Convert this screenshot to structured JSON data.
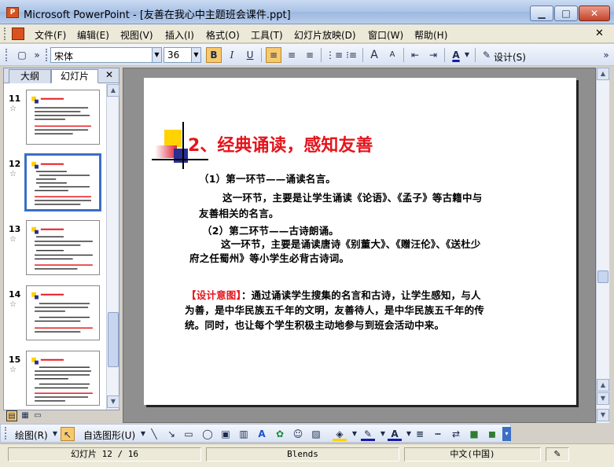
{
  "window": {
    "app_icon": "powerpoint-icon",
    "title": "Microsoft PowerPoint - [友善在我心中主题班会课件.ppt]",
    "min_glyph": "▁",
    "max_glyph": "□",
    "close_glyph": "✕"
  },
  "menu": {
    "items": [
      "文件(F)",
      "编辑(E)",
      "视图(V)",
      "插入(I)",
      "格式(O)",
      "工具(T)",
      "幻灯片放映(D)",
      "窗口(W)",
      "帮助(H)"
    ],
    "close_glyph": "✕"
  },
  "toolbar": {
    "font_name": "宋体",
    "font_size": "36",
    "bold": "B",
    "italic": "I",
    "underline": "U",
    "increase_font": "A",
    "decrease_font": "A",
    "font_color": "A",
    "design_label": "设计(S)"
  },
  "left_pane": {
    "tab_outline": "大纲",
    "tab_slides": "幻灯片",
    "close_glyph": "✕",
    "slides": [
      {
        "number": "11",
        "selected": false
      },
      {
        "number": "12",
        "selected": true
      },
      {
        "number": "13",
        "selected": false
      },
      {
        "number": "14",
        "selected": false
      },
      {
        "number": "15",
        "selected": false
      }
    ]
  },
  "slide": {
    "title_num": "2",
    "title_text": "、经典诵读，感知友善",
    "p1_head": "（1）第一环节——诵读名言。",
    "p1_line1": "这一环节，主要是让学生诵读《论语》、《孟子》等古籍中与",
    "p1_line2": "友善相关的名言。",
    "p2_head": "（2）第二环节——古诗朗诵。",
    "p2_line1": "这一环节，主要是诵读唐诗《别董大》、《赠汪伦》、《送杜少",
    "p2_line2": "府之任蜀州》等小学生必背古诗词。",
    "design_tag": "【设计意图】",
    "design_line1": "：通过诵读学生搜集的名言和古诗，让学生感知，与人",
    "design_line2": "为善，是中华民族五千年的文明，友善待人，是中华民族五千年的传",
    "design_line3": "统。同时，也让每个学生积极主动地参与到班会活动中来。"
  },
  "draw_toolbar": {
    "draw_label": "绘图(R)",
    "autoshapes_label": "自选图形(U)"
  },
  "status": {
    "slide_pos": "幻灯片 12 / 16",
    "template": "Blends",
    "language": "中文(中国)"
  }
}
